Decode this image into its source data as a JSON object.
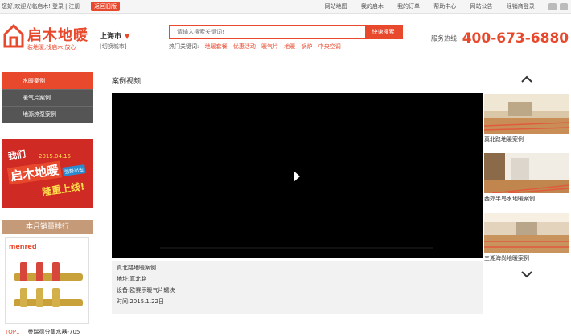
{
  "topbar": {
    "greeting": "您好,欢迎光临启木!",
    "login": "登录",
    "separator": "|",
    "register": "注册",
    "old_version": "返回旧版",
    "links": [
      "网站地图",
      "我的启木",
      "我的订单",
      "帮助中心",
      "网站公告",
      "经销商登录"
    ],
    "icons": [
      "wechat-icon",
      "weibo-icon"
    ]
  },
  "header": {
    "brand": "启木地暖",
    "slogan": "装地暖,找启木,放心",
    "city": "上海市",
    "city_switch": "[切换城市]",
    "search_placeholder": "请输入搜索关键词!",
    "search_button": "快速搜索",
    "hot_label": "热门关键词:",
    "hot_keywords": [
      "地暖套餐",
      "优惠活动",
      "暖气片",
      "地暖",
      "锅炉",
      "中央空调"
    ],
    "hotline_label": "服务热线:",
    "hotline_number": "400-673-6880"
  },
  "sidebar": {
    "items": [
      {
        "label": "水暖案例",
        "active": true
      },
      {
        "label": "暖气片案例",
        "active": false
      },
      {
        "label": "地源热泵案例",
        "active": false
      }
    ]
  },
  "banner": {
    "line1": "我们",
    "date": "2015.04.15",
    "brand": "启木地暖",
    "tag": "强势出击",
    "slogan": "隆重上线!"
  },
  "ranking": {
    "title": "本月销量排行",
    "brand": "menred",
    "items": [
      {
        "rank": "TOP1",
        "name": "曼瑞德分集水器-705"
      }
    ]
  },
  "main": {
    "title": "案例视频",
    "case": {
      "name": "真北路地暖案例",
      "address": "地址:真北路",
      "equipment": "设备:欧赛乐暖气片蠕块",
      "time": "时间:2015.1.22日"
    }
  },
  "thumbs": [
    {
      "caption": "真北路地暖案例"
    },
    {
      "caption": "西郊半岛水地暖案例"
    },
    {
      "caption": "三湘海尚地暖案例"
    }
  ],
  "colors": {
    "accent": "#e8492d",
    "sidebar_bg": "#555555",
    "rank_header": "#c59a78"
  }
}
